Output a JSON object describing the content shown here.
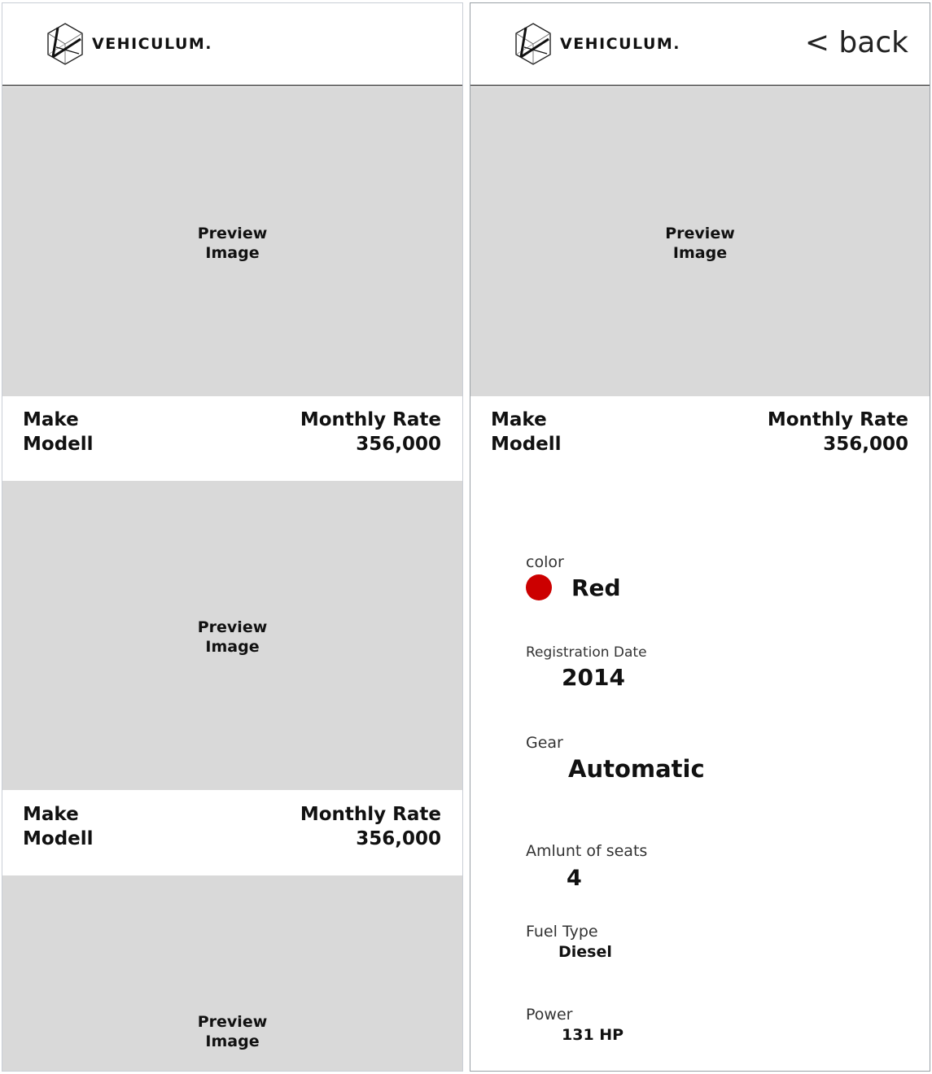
{
  "brand": {
    "name": "VEHICULUM."
  },
  "list_panel": {
    "cards": [
      {
        "preview": "Preview\nImage",
        "make": "Make",
        "model": "Modell",
        "rate_label": "Monthly Rate",
        "rate_value": "356,000"
      },
      {
        "preview": "Preview\nImage",
        "make": "Make",
        "model": "Modell",
        "rate_label": "Monthly Rate",
        "rate_value": "356,000"
      },
      {
        "preview": "Preview\nImage"
      }
    ]
  },
  "detail_panel": {
    "back_label": "< back",
    "preview": "Preview\nImage",
    "make": "Make",
    "model": "Modell",
    "rate_label": "Monthly Rate",
    "rate_value": "356,000",
    "specs": {
      "color": {
        "label": "color",
        "value": "Red",
        "swatch": "#cc0000"
      },
      "registration": {
        "label": "Registration Date",
        "value": "2014"
      },
      "gear": {
        "label": "Gear",
        "value": "Automatic"
      },
      "seats": {
        "label": "Amlunt of seats",
        "value": "4"
      },
      "fuel": {
        "label": "Fuel Type",
        "value": "Diesel"
      },
      "power": {
        "label": "Power",
        "value": "131 HP"
      }
    }
  },
  "colors": {
    "preview_bg": "#d9d9d9",
    "header_rule": "#6f6f6f",
    "accent_red": "#cc0000"
  }
}
